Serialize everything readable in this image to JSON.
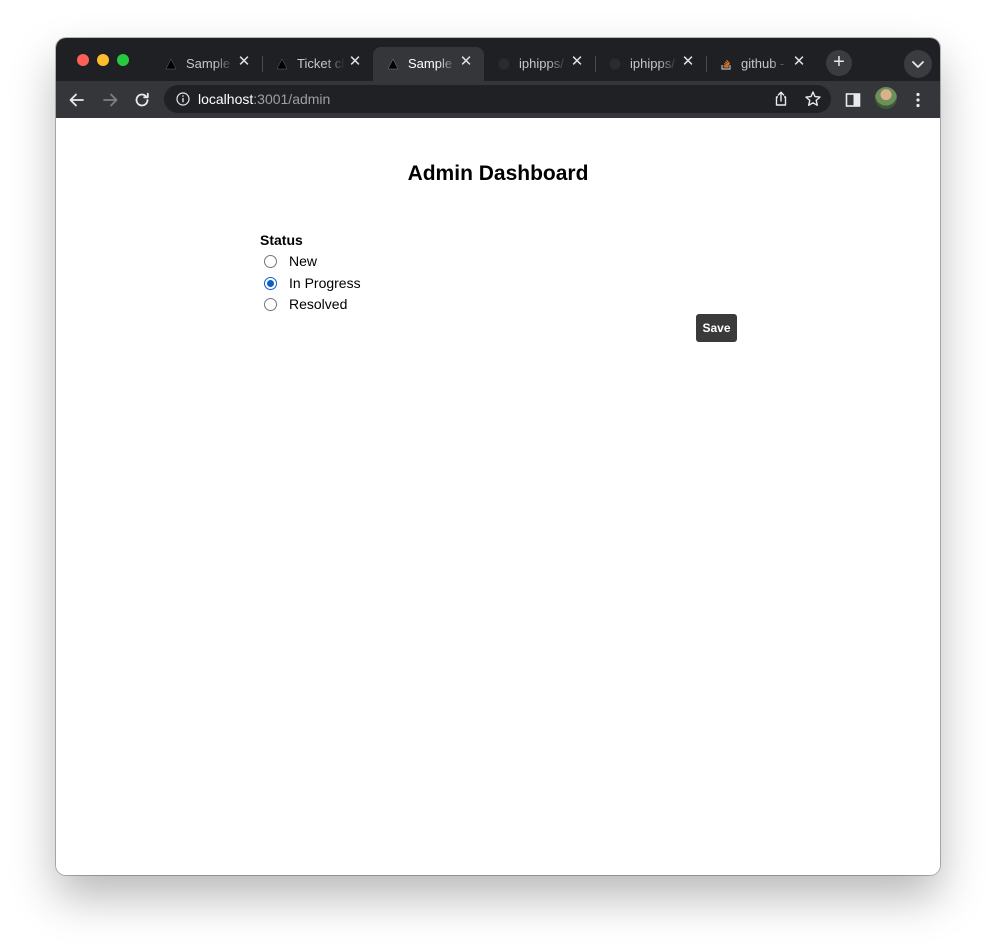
{
  "browser": {
    "tabs": [
      {
        "title": "Sample",
        "favicon": "triangle-logo-icon",
        "active": false
      },
      {
        "title": "Ticket cl",
        "favicon": "triangle-logo-icon",
        "active": false
      },
      {
        "title": "Sample",
        "favicon": "triangle-logo-icon",
        "active": true
      },
      {
        "title": "iphipps/",
        "favicon": "github-icon",
        "active": false
      },
      {
        "title": "iphipps/",
        "favicon": "github-icon",
        "active": false
      },
      {
        "title": "github -",
        "favicon": "stackoverflow-icon",
        "active": false
      }
    ],
    "address": {
      "host": "localhost",
      "rest": ":3001/admin"
    }
  },
  "page": {
    "title": "Admin Dashboard",
    "status_label": "Status",
    "options": [
      {
        "label": "New",
        "checked": false
      },
      {
        "label": "In Progress",
        "checked": true
      },
      {
        "label": "Resolved",
        "checked": false
      }
    ],
    "save_label": "Save"
  },
  "colors": {
    "tabstrip": "#1f2023",
    "toolbar": "#35363a",
    "radio_accent": "#0b5fc7",
    "save_button": "#3a3a3a"
  }
}
